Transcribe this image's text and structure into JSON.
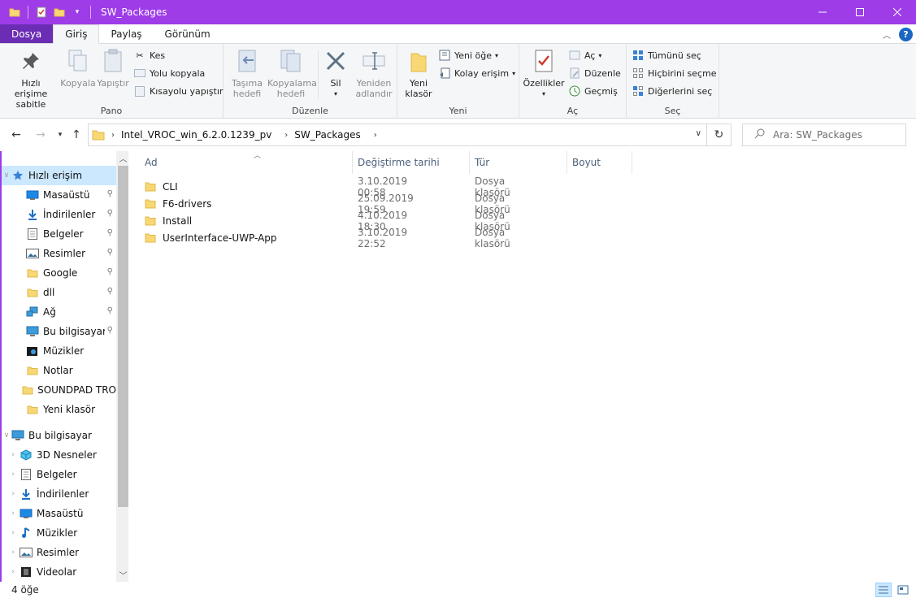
{
  "window": {
    "title": "SW_Packages",
    "accent": "#9e3ce8"
  },
  "tabs": [
    {
      "label": "Dosya"
    },
    {
      "label": "Giriş"
    },
    {
      "label": "Paylaş"
    },
    {
      "label": "Görünüm"
    }
  ],
  "ribbon": {
    "pano": {
      "label": "Pano",
      "pin": "Hızlı erişime sabitle",
      "copy": "Kopyala",
      "paste": "Yapıştır",
      "cut": "Kes",
      "copy_path": "Yolu kopyala",
      "paste_shortcut": "Kısayolu yapıştır"
    },
    "duzenle": {
      "label": "Düzenle",
      "move_to": "Taşıma hedefi",
      "copy_to": "Kopyalama hedefi",
      "delete": "Sil",
      "rename": "Yeniden adlandır"
    },
    "yeni": {
      "label": "Yeni",
      "new_folder": "Yeni klasör",
      "new_item": "Yeni öğe",
      "easy_access": "Kolay erişim"
    },
    "ac": {
      "label": "Aç",
      "properties": "Özellikler",
      "open": "Aç",
      "edit": "Düzenle",
      "history": "Geçmiş"
    },
    "sec": {
      "label": "Seç",
      "select_all": "Tümünü seç",
      "select_none": "Hiçbirini seçme",
      "invert": "Diğerlerini seç"
    }
  },
  "address": {
    "crumbs": [
      "Intel_VROC_win_6.2.0.1239_pv",
      "SW_Packages"
    ],
    "search_placeholder": "Ara: SW_Packages"
  },
  "nav": {
    "quick_access": "Hızlı erişim",
    "quick_items": [
      {
        "label": "Masaüstü",
        "icon": "desktop-icon"
      },
      {
        "label": "İndirilenler",
        "icon": "download-icon"
      },
      {
        "label": "Belgeler",
        "icon": "document-icon"
      },
      {
        "label": "Resimler",
        "icon": "pictures-icon"
      },
      {
        "label": "Google",
        "icon": "folder-icon"
      },
      {
        "label": "dll",
        "icon": "folder-icon"
      },
      {
        "label": "Ağ",
        "icon": "network-icon"
      },
      {
        "label": "Bu bilgisayar",
        "icon": "computer-icon"
      },
      {
        "label": "Müzikler",
        "icon": "music-folder-icon"
      },
      {
        "label": "Notlar",
        "icon": "folder-icon"
      },
      {
        "label": "SOUNDPAD TRO",
        "icon": "folder-icon"
      },
      {
        "label": "Yeni klasör",
        "icon": "folder-icon"
      }
    ],
    "this_pc": "Bu bilgisayar",
    "pc_items": [
      {
        "label": "3D Nesneler",
        "icon": "3d-objects-icon"
      },
      {
        "label": "Belgeler",
        "icon": "document-icon"
      },
      {
        "label": "İndirilenler",
        "icon": "download-icon"
      },
      {
        "label": "Masaüstü",
        "icon": "desktop-icon"
      },
      {
        "label": "Müzikler",
        "icon": "music-icon"
      },
      {
        "label": "Resimler",
        "icon": "pictures-icon"
      },
      {
        "label": "Videolar",
        "icon": "video-icon"
      }
    ]
  },
  "columns": {
    "name": "Ad",
    "date": "Değiştirme tarihi",
    "type": "Tür",
    "size": "Boyut"
  },
  "files": [
    {
      "name": "CLI",
      "date": "3.10.2019 00:58",
      "type": "Dosya klasörü"
    },
    {
      "name": "F6-drivers",
      "date": "25.09.2019 19:59",
      "type": "Dosya klasörü"
    },
    {
      "name": "Install",
      "date": "4.10.2019 18:30",
      "type": "Dosya klasörü"
    },
    {
      "name": "UserInterface-UWP-App",
      "date": "3.10.2019 22:52",
      "type": "Dosya klasörü"
    }
  ],
  "status": {
    "count": "4 öğe"
  }
}
